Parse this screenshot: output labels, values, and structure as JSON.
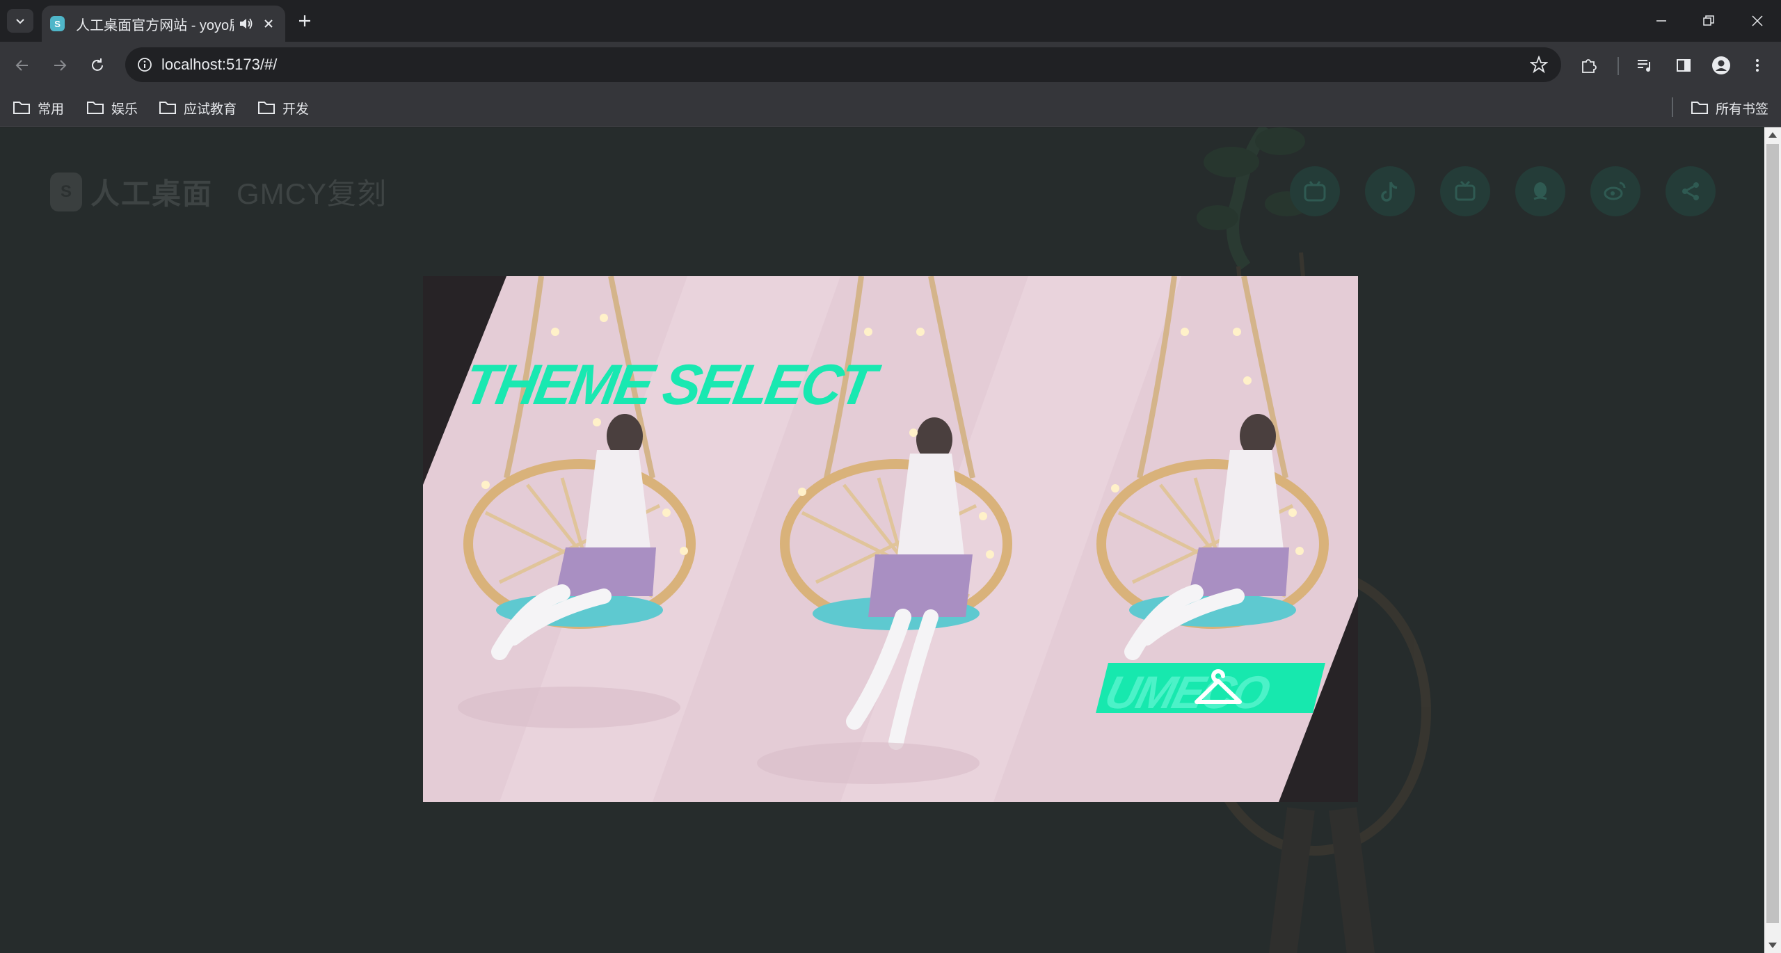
{
  "browser": {
    "tab_title": "人工桌面官方网站 - yoyo鹿",
    "tab_favicon_letter": "S",
    "url": "localhost:5173/#/",
    "bookmarks": [
      "常用",
      "娱乐",
      "应试教育",
      "开发"
    ],
    "all_bookmarks_label": "所有书签",
    "icons": [
      "tab-search-icon",
      "speaker-icon",
      "close-icon",
      "plus-icon",
      "minimize-icon",
      "restore-icon",
      "window-close-icon",
      "back-arrow-icon",
      "forward-arrow-icon",
      "reload-icon",
      "info-icon",
      "star-icon",
      "extensions-icon",
      "media-control-icon",
      "side-panel-icon",
      "profile-icon",
      "more-vert-icon",
      "folder-icon"
    ]
  },
  "page": {
    "logo_mark": "S",
    "logo_text": "人工桌面",
    "logo_subtitle": "GMCY复刻",
    "social_icons": [
      "bilibili-icon",
      "tiktok-icon",
      "tv-icon",
      "qq-icon",
      "weibo-icon",
      "share-icon"
    ],
    "accent_color": "#19e8b1"
  },
  "theme_card": {
    "title": "THEME SELECT",
    "badge_text": "UMECO",
    "badge_icon": "hanger-icon",
    "background_color": "#e4ccd6"
  }
}
